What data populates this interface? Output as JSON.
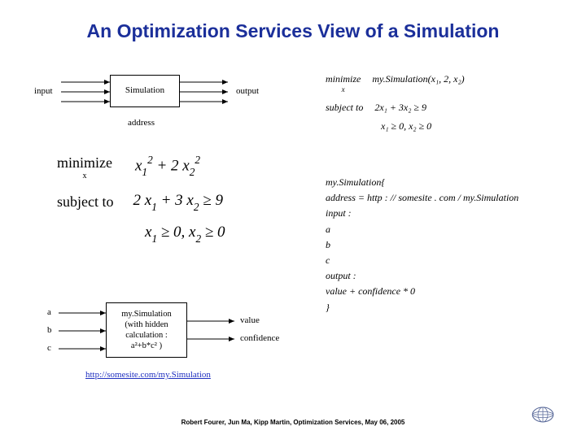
{
  "title": "An Optimization Services View of a Simulation",
  "footer": "Robert Fourer, Jun Ma, Kipp Martin, Optimization Services, May 06, 2005",
  "fig_top": {
    "input_label": "input",
    "box_label": "Simulation",
    "output_label": "output",
    "address_label": "address"
  },
  "math_right_small": {
    "min_label": "minimize",
    "min_sub": "x",
    "objective": "my.Simulation(x₁, 2, x₂)",
    "st_label": "subject to",
    "con1": "2x₁ + 3x₂ ≥ 9",
    "con2": "x₁ ≥ 0, x₂ ≥ 0"
  },
  "math_left_big": {
    "min_label": "minimize",
    "min_sub": "x",
    "objective_html": "x<span class=\"sub\">1</span><span class=\"sup\">2</span> + 2 x<span class=\"sub\">2</span><span class=\"sup\">2</span>",
    "st_label": "subject to",
    "con1_html": "2 x<span class=\"sub\">1</span> + 3 x<span class=\"sub\">2</span> ≥ 9",
    "con2_html": "x<span class=\"sub\">1</span> ≥ 0,  x<span class=\"sub\">2</span> ≥ 0"
  },
  "sim_def": {
    "header": "my.Simulation{",
    "addr_line": "address = http : // somesite . com / my.Simulation",
    "input_kw": "input :",
    "in_a": "a",
    "in_b": "b",
    "in_c": "c",
    "output_kw": "output :",
    "out_line": "value + confidence * 0",
    "close": "}"
  },
  "fig_bottom": {
    "a": "a",
    "b": "b",
    "c": "c",
    "box_l1": "my.Simulation",
    "box_l2": "(with hidden",
    "box_l3": "calculation :",
    "box_l4": "a²+b*c² )",
    "out1": "value",
    "out2": "confidence"
  },
  "link": "http://somesite.com/my.Simulation"
}
